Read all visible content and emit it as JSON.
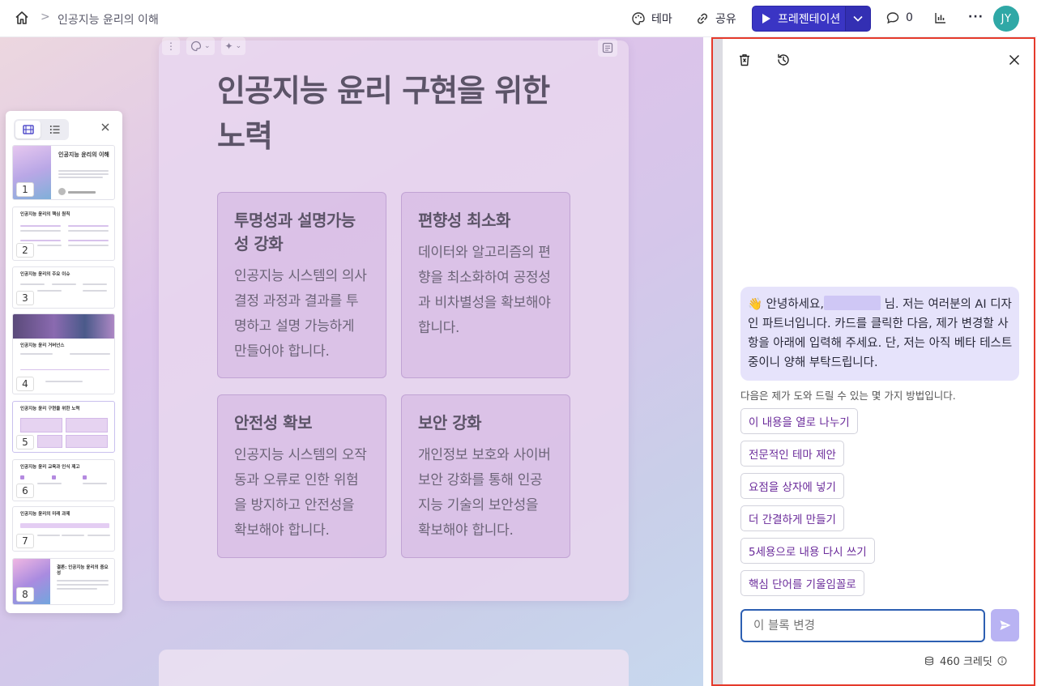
{
  "breadcrumb": {
    "separator": ">",
    "current": "인공지능 윤리의 이해"
  },
  "toolbar": {
    "theme_label": "테마",
    "share_label": "공유",
    "present_label": "프레젠테이션",
    "comments_count": "0",
    "avatar_initials": "JY",
    "more_label": "···"
  },
  "slide": {
    "title": "인공지능 윤리 구현을 위한 노력",
    "boxes": [
      {
        "heading": "투명성과 설명가능성 강화",
        "body": "인공지능 시스템의 의사결정 과정과 결과를 투명하고 설명 가능하게 만들어야 합니다."
      },
      {
        "heading": "편향성 최소화",
        "body": "데이터와 알고리즘의 편향을 최소화하여 공정성과 비차별성을 확보해야 합니다."
      },
      {
        "heading": "안전성 확보",
        "body": "인공지능 시스템의 오작동과 오류로 인한 위험을 방지하고 안전성을 확보해야 합니다."
      },
      {
        "heading": "보안 강화",
        "body": "개인정보 보호와 사이버 보안 강화를 통해 인공지능 기술의 보안성을 확보해야 합니다."
      }
    ]
  },
  "thumbnails": [
    {
      "num": "1",
      "title": "인공지능 윤리의 이해"
    },
    {
      "num": "2",
      "title": "인공지능 윤리의 핵심 원칙"
    },
    {
      "num": "3",
      "title": "인공지능 윤리의 주요 이슈"
    },
    {
      "num": "4",
      "title": "인공지능 윤리 거버넌스"
    },
    {
      "num": "5",
      "title": "인공지능 윤리 구현을 위한 노력"
    },
    {
      "num": "6",
      "title": "인공지능 윤리 교육과 인식 제고"
    },
    {
      "num": "7",
      "title": "인공지능 윤리의 미래 과제"
    },
    {
      "num": "8",
      "title": "결론: 인공지능 윤리의 중요성"
    }
  ],
  "chat": {
    "greeting_before": "👋 안녕하세요,",
    "greeting_after": "님. 저는 여러분의 AI 디자인 파트너입니다. 카드를 클릭한 다음, 제가 변경할 사항을 아래에 입력해 주세요. 단, 저는 아직 베타 테스트 중이니 양해 부탁드립니다.",
    "helper": "다음은 제가 도와 드릴 수 있는 몇 가지 방법입니다.",
    "suggestions": [
      "이 내용을 열로 나누기",
      "전문적인 테마 제안",
      "요점을 상자에 넣기",
      "더 간결하게 만들기",
      "5세용으로 내용 다시 쓰기",
      "핵심 단어를 기울임꼴로"
    ],
    "input_placeholder": "이 블록 변경",
    "credits": "460 크레딧"
  },
  "colors": {
    "present_button": "#3a35c4",
    "avatar": "#2fa8a6",
    "chat_border": "#e53a2b",
    "bubble": "#e6e3fb",
    "suggestion_text": "#6a2a9a",
    "input_border": "#2d5fb2",
    "send_button": "#b9b3f3"
  },
  "icons": {
    "home": "home-icon",
    "theme": "palette-icon",
    "share": "link-icon",
    "present": "play-icon",
    "comments": "comment-icon",
    "analytics": "bar-chart-icon",
    "delete": "trash-icon",
    "history": "history-icon",
    "close": "close-icon",
    "send": "send-icon",
    "credits": "coins-icon",
    "info": "info-icon"
  }
}
